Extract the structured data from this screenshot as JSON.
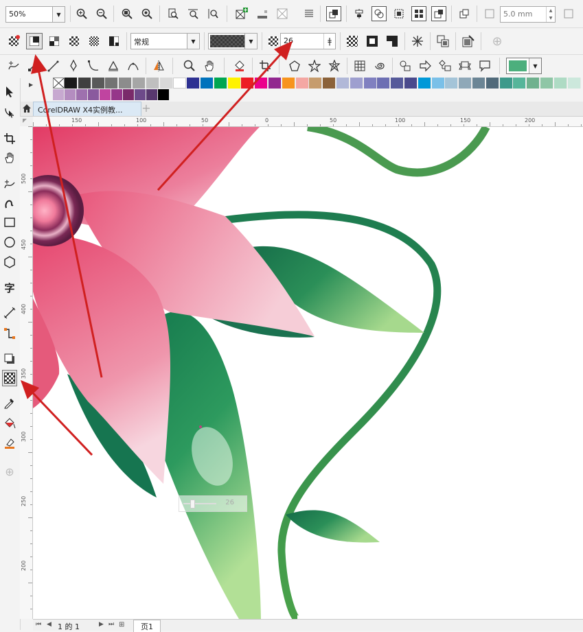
{
  "toolbar": {
    "zoom_value": "50%",
    "nib_width": "5.0 mm"
  },
  "property_bar": {
    "transparency_mode": "常规",
    "transparency_value": "26"
  },
  "document": {
    "tab_title": "CorelDRAW X4实例教..."
  },
  "ruler": {
    "horizontal_labels": [
      "150",
      "100",
      "50",
      "0",
      "50",
      "100",
      "150",
      "200"
    ],
    "vertical_labels": [
      "500",
      "450",
      "400",
      "350",
      "300",
      "250",
      "200"
    ]
  },
  "status": {
    "page_counter": "1 的 1",
    "page_tab": "页1"
  },
  "floating_slider": {
    "value": "26"
  },
  "colors": {
    "palette_row1": [
      "#1a1a1a",
      "#404040",
      "#595959",
      "#737373",
      "#8c8c8c",
      "#a6a6a6",
      "#bfbfbf",
      "#d9d9d9",
      "#ffffff",
      "#2e3192",
      "#0072bc",
      "#00a651",
      "#fff200",
      "#ed1c24",
      "#ec008c",
      "#92278f",
      "#f7941d",
      "#f4a7a3",
      "#c69c6d",
      "#8c6239",
      "#b1b8d8",
      "#9e9fcf",
      "#8080c0",
      "#6d6fb3",
      "#565a9a",
      "#4a4a8c",
      "#0099d8",
      "#7ac0e8",
      "#a4c4d8",
      "#8fa8b8",
      "#6b8595",
      "#506a7a",
      "#3d9a8b",
      "#56b59a",
      "#6fb18e",
      "#8fc6a6",
      "#aedbc4",
      "#cce8dc"
    ],
    "palette_row2": [
      "#c7a9d0",
      "#b48dc0",
      "#9e71ae",
      "#8a5a9e",
      "#c044a0",
      "#96368a",
      "#7a2a6a",
      "#6d4a8a",
      "#58386e",
      "#000000"
    ],
    "fill_swatch": "#4caf7d",
    "annotation_arrow": "#d02020"
  }
}
